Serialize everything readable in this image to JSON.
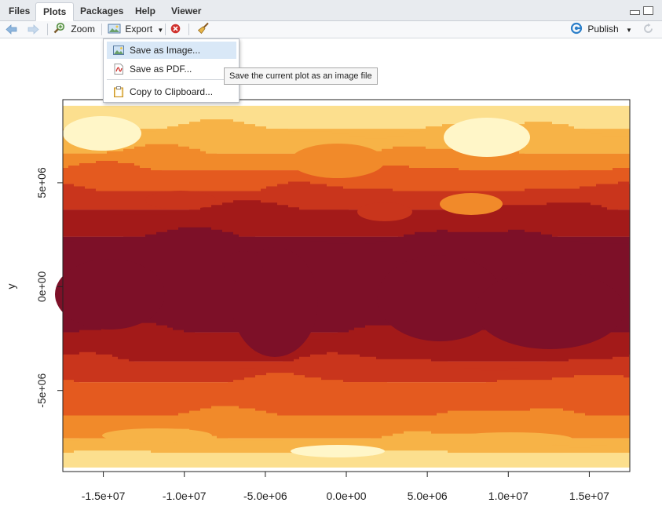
{
  "tabs": [
    {
      "label": "Files",
      "active": false
    },
    {
      "label": "Plots",
      "active": true
    },
    {
      "label": "Packages",
      "active": false
    },
    {
      "label": "Help",
      "active": false
    },
    {
      "label": "Viewer",
      "active": false
    }
  ],
  "toolbar": {
    "back_icon": "arrow-left-icon",
    "forward_icon": "arrow-right-icon",
    "zoom_label": "Zoom",
    "export_label": "Export",
    "publish_label": "Publish",
    "colors": {
      "accent": "#2c7fc9",
      "remove": "#d0312d"
    }
  },
  "export_menu": {
    "items": [
      {
        "label": "Save as Image...",
        "icon": "image-icon",
        "highlighted": true
      },
      {
        "label": "Save as PDF...",
        "icon": "pdf-icon",
        "highlighted": false
      },
      {
        "label": "Copy to Clipboard...",
        "icon": "clipboard-icon",
        "highlighted": false
      }
    ]
  },
  "tooltip": {
    "text": "Save the current plot as an image file"
  },
  "chart_data": {
    "type": "heatmap",
    "ylabel": "y",
    "x_ticks": [
      "-1.5e+07",
      "-1.0e+07",
      "-5.0e+06",
      "0.0e+00",
      "5.0e+06",
      "1.0e+07",
      "1.5e+07"
    ],
    "x_tick_values": [
      -15000000,
      -10000000,
      -5000000,
      0,
      5000000,
      10000000,
      15000000
    ],
    "y_ticks": [
      "-5e+06",
      "0e+00",
      "5e+06"
    ],
    "y_tick_values": [
      -5000000,
      0,
      5000000
    ],
    "xlim": [
      -17500000,
      17500000
    ],
    "ylim": [
      -8900000,
      9000000
    ],
    "raster_extent": {
      "x": [
        -17500000,
        17500000
      ],
      "y": [
        -8700000,
        8700000
      ]
    },
    "palette": [
      "#fff6c8",
      "#fcdf8e",
      "#f7b347",
      "#f18a2a",
      "#e45a1f",
      "#c9351c",
      "#a31a19",
      "#7d1028"
    ],
    "zones": [
      {
        "y_from": 8700000,
        "y_to": 7600000,
        "class": 1
      },
      {
        "y_from": 7600000,
        "y_to": 6400000,
        "class": 2
      },
      {
        "y_from": 6400000,
        "y_to": 5600000,
        "class": 3
      },
      {
        "y_from": 5600000,
        "y_to": 4600000,
        "class": 4
      },
      {
        "y_from": 4600000,
        "y_to": 3700000,
        "class": 5
      },
      {
        "y_from": 3700000,
        "y_to": 2400000,
        "class": 6
      },
      {
        "y_from": 2400000,
        "y_to": -2200000,
        "class": 7
      },
      {
        "y_from": -2200000,
        "y_to": -3600000,
        "class": 6
      },
      {
        "y_from": -3600000,
        "y_to": -4600000,
        "class": 5
      },
      {
        "y_from": -4600000,
        "y_to": -6200000,
        "class": 4
      },
      {
        "y_from": -6200000,
        "y_to": -7300000,
        "class": 3
      },
      {
        "y_from": -7300000,
        "y_to": -8000000,
        "class": 2
      },
      {
        "y_from": -8000000,
        "y_to": -8700000,
        "class": 1
      }
    ]
  }
}
